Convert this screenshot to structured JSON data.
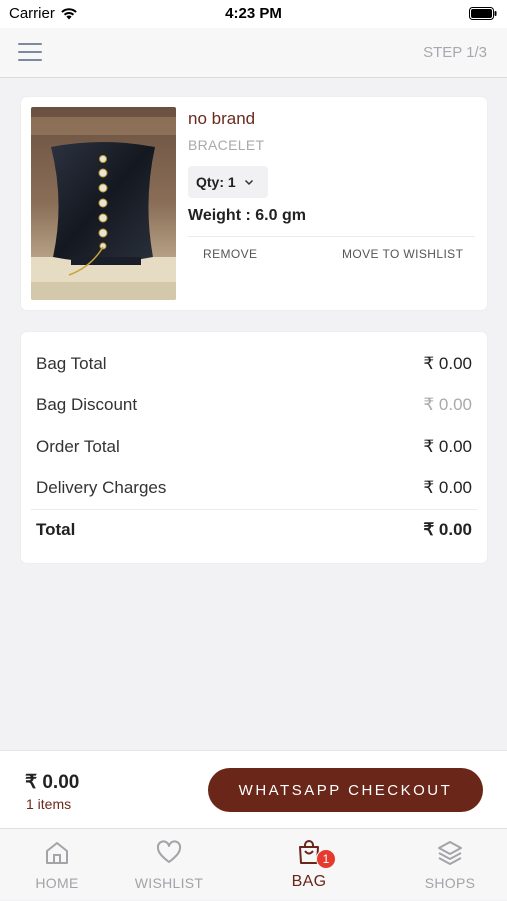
{
  "status_bar": {
    "carrier": "Carrier",
    "time": "4:23 PM"
  },
  "header": {
    "step": "STEP 1/3"
  },
  "cart_item": {
    "brand": "no brand",
    "category": "BRACELET",
    "qty_label": "Qty: 1",
    "weight": "Weight : 6.0 gm",
    "remove_label": "REMOVE",
    "move_to_wishlist_label": "MOVE TO WISHLIST"
  },
  "summary": {
    "rows": [
      {
        "label": "Bag Total",
        "value": "₹ 0.00"
      },
      {
        "label": "Bag Discount",
        "value": "₹ 0.00"
      },
      {
        "label": "Order Total",
        "value": "₹ 0.00"
      },
      {
        "label": "Delivery Charges",
        "value": "₹ 0.00"
      }
    ],
    "total": {
      "label": "Total",
      "value": "₹ 0.00"
    }
  },
  "checkout_bar": {
    "price": "₹ 0.00",
    "items": "1 items",
    "button_label": "WHATSAPP CHECKOUT"
  },
  "tabs": [
    {
      "label": "HOME",
      "icon": "home-icon"
    },
    {
      "label": "WISHLIST",
      "icon": "heart-icon"
    },
    {
      "label": "BAG",
      "icon": "bag-icon",
      "badge": "1",
      "active": true
    },
    {
      "label": "SHOPS",
      "icon": "layers-icon"
    }
  ],
  "colors": {
    "accent": "#6a2618",
    "badge": "#e53b2e"
  }
}
